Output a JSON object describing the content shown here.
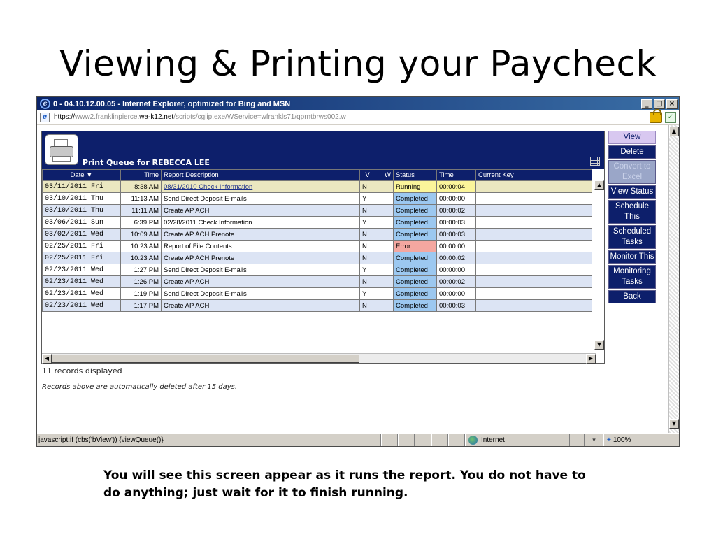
{
  "slide": {
    "title": "Viewing & Printing your Paycheck",
    "caption": "You will see this screen appear as it runs the report. You do not have to do anything; just wait for it to finish running."
  },
  "window": {
    "title": "0 - 04.10.12.00.05 - Internet Explorer, optimized for Bing and MSN",
    "controls": [
      "_",
      "□",
      "×"
    ]
  },
  "address": {
    "scheme": "https://",
    "host_pre": "www2.franklinpierce.",
    "host": "wa-k12.net",
    "path": "/scripts/cgiip.exe/WService=wfrankls71/qprntbrws002.w"
  },
  "queue": {
    "title": "Print Queue for REBECCA LEE",
    "columns": {
      "date": "Date ▼",
      "time": "Time",
      "desc": "Report Description",
      "v": "V",
      "w": "W",
      "status": "Status",
      "runtime": "Time",
      "key": "Current Key"
    },
    "rows": [
      {
        "date": "03/11/2011 Fri",
        "time": "8:38 AM",
        "desc": "08/31/2010 Check Information",
        "v": "N",
        "w": "",
        "status": "Running",
        "runtime": "00:00:04",
        "key": ""
      },
      {
        "date": "03/10/2011 Thu",
        "time": "11:13 AM",
        "desc": "Send Direct Deposit E-mails",
        "v": "Y",
        "w": "",
        "status": "Completed",
        "runtime": "00:00:00",
        "key": ""
      },
      {
        "date": "03/10/2011 Thu",
        "time": "11:11 AM",
        "desc": "Create AP ACH",
        "v": "N",
        "w": "",
        "status": "Completed",
        "runtime": "00:00:02",
        "key": ""
      },
      {
        "date": "03/06/2011 Sun",
        "time": "6:39 PM",
        "desc": "02/28/2011 Check Information",
        "v": "Y",
        "w": "",
        "status": "Completed",
        "runtime": "00:00:03",
        "key": ""
      },
      {
        "date": "03/02/2011 Wed",
        "time": "10:09 AM",
        "desc": "Create AP ACH Prenote",
        "v": "N",
        "w": "",
        "status": "Completed",
        "runtime": "00:00:03",
        "key": ""
      },
      {
        "date": "02/25/2011 Fri",
        "time": "10:23 AM",
        "desc": "Report of File Contents",
        "v": "N",
        "w": "",
        "status": "Error",
        "runtime": "00:00:00",
        "key": ""
      },
      {
        "date": "02/25/2011 Fri",
        "time": "10:23 AM",
        "desc": "Create AP ACH Prenote",
        "v": "N",
        "w": "",
        "status": "Completed",
        "runtime": "00:00:02",
        "key": ""
      },
      {
        "date": "02/23/2011 Wed",
        "time": "1:27 PM",
        "desc": "Send Direct Deposit E-mails",
        "v": "Y",
        "w": "",
        "status": "Completed",
        "runtime": "00:00:00",
        "key": ""
      },
      {
        "date": "02/23/2011 Wed",
        "time": "1:26 PM",
        "desc": "Create AP ACH",
        "v": "N",
        "w": "",
        "status": "Completed",
        "runtime": "00:00:02",
        "key": ""
      },
      {
        "date": "02/23/2011 Wed",
        "time": "1:19 PM",
        "desc": "Send Direct Deposit E-mails",
        "v": "Y",
        "w": "",
        "status": "Completed",
        "runtime": "00:00:00",
        "key": ""
      },
      {
        "date": "02/23/2011 Wed",
        "time": "1:17 PM",
        "desc": "Create AP ACH",
        "v": "N",
        "w": "",
        "status": "Completed",
        "runtime": "00:00:03",
        "key": ""
      }
    ],
    "records_info": "11 records displayed",
    "records_note": "Records above are automatically deleted after 15 days."
  },
  "side_buttons": [
    {
      "label": "View",
      "state": "active"
    },
    {
      "label": "Delete",
      "state": "normal"
    },
    {
      "label": "Convert to Excel",
      "state": "disabled"
    },
    {
      "label": "View Status",
      "state": "normal"
    },
    {
      "label": "Schedule This",
      "state": "normal"
    },
    {
      "label": "Scheduled Tasks",
      "state": "normal"
    },
    {
      "label": "Monitor This",
      "state": "normal"
    },
    {
      "label": "Monitoring Tasks",
      "state": "normal"
    },
    {
      "label": "Back",
      "state": "normal"
    }
  ],
  "statusbar": {
    "text": "javascript:if (cbs('bView')) {viewQueue()}",
    "zone": "Internet",
    "zoom": "100%"
  },
  "colors": {
    "header_navy": "#0d1f6b",
    "running": "#fbf59a",
    "completed": "#9cc8f0",
    "error": "#f4a7a0"
  }
}
